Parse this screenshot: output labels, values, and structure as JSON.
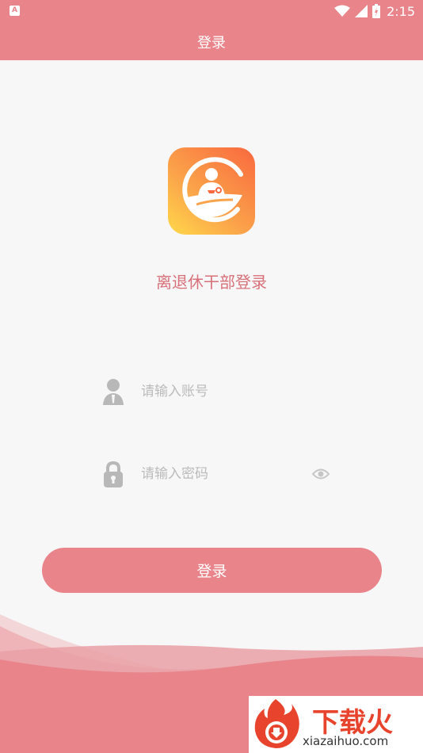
{
  "status_bar": {
    "notification_icon": "A",
    "time": "2:15"
  },
  "header": {
    "title": "登录"
  },
  "app": {
    "name": "离退休干部登录",
    "logo_icon": "party-emblem-logo-icon"
  },
  "form": {
    "account": {
      "placeholder": "请输入账号",
      "value": ""
    },
    "password": {
      "placeholder": "请输入密码",
      "value": ""
    },
    "login_label": "登录"
  },
  "watermark": {
    "title": "下载火",
    "url": "xiazaihuo.com"
  },
  "colors": {
    "primary": "#e8848a",
    "accent_text": "#d8707a",
    "background": "#f7f7f7"
  }
}
